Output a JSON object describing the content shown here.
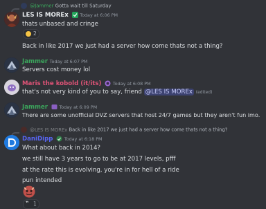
{
  "messages": {
    "m0": {
      "reply_author": "@Jammer",
      "reply_text": "Gotta wait till Saturday",
      "author": "LES IS MOREx",
      "timestamp": "Today at 6:06 PM",
      "line1": "thats unbased and cringe",
      "reaction_count": "2",
      "line2": "Back in like 2017 we just had a server how come thats not a thing?"
    },
    "m1": {
      "author": "Jammer",
      "timestamp": "Today at 6:07 PM",
      "line1": "Servers cost money lol"
    },
    "m2": {
      "author": "Maris the kobold (it/its)",
      "timestamp": "Today at 6:08 PM",
      "line1": "that's not very kind of you to say, friend",
      "mention": "@LES IS MOREx",
      "edited": "(edited)"
    },
    "m3": {
      "author": "Jammer",
      "timestamp": "Today at 6:09 PM",
      "line1": "There are some unofficial DVZ servers that host 24/7 games but they aren't fun imo."
    },
    "m4": {
      "reply_author": "@LES IS MOREx",
      "reply_text": "Back in like 2017 we just had a server how come thats not a thing?",
      "author": "DaniDipp",
      "timestamp": "Today at 6:18 PM",
      "line1": "What about back in 2014?",
      "line2": "we still have 3 years to go to be at 2017 levels, pfff",
      "line3": "at the rate this is evolving, you're in for hell of a ride",
      "line4": "pun intended",
      "reaction_count": "1"
    }
  },
  "colors": {
    "background": "#313338",
    "jammer": "#3ba55c",
    "maris": "#e05377",
    "danidipp": "#5865f2",
    "les": "#e8ecef",
    "timestamp": "#949ba4"
  }
}
